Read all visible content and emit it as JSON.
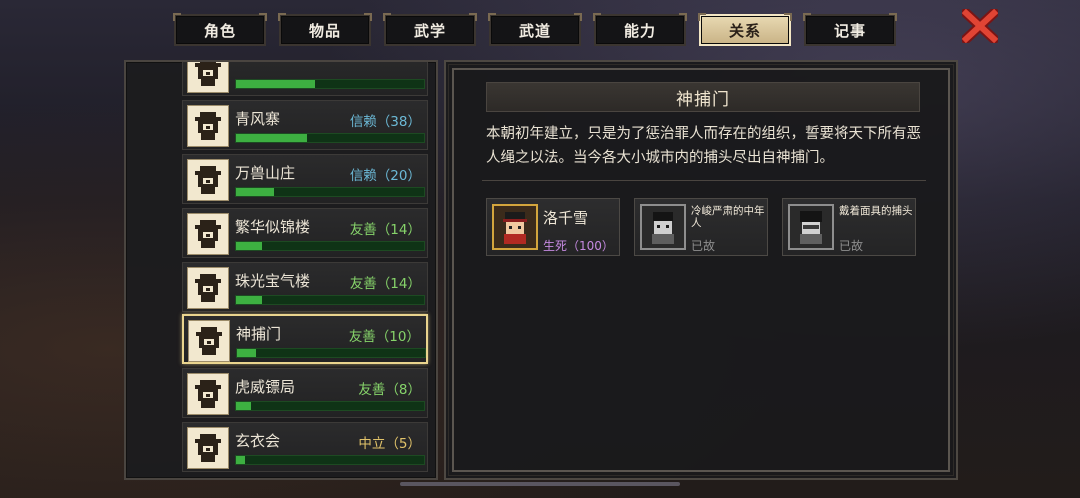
{
  "tabs": [
    {
      "label": "角色",
      "active": false
    },
    {
      "label": "物品",
      "active": false
    },
    {
      "label": "武学",
      "active": false
    },
    {
      "label": "武道",
      "active": false
    },
    {
      "label": "能力",
      "active": false
    },
    {
      "label": "关系",
      "active": true
    },
    {
      "label": "记事",
      "active": false
    }
  ],
  "close_icon": "close-icon",
  "factions": [
    {
      "name": "",
      "status": "",
      "status_type": "trust",
      "progress": 0.42,
      "icon": "faction-emblem-icon"
    },
    {
      "name": "青风寨",
      "status": "信赖（38）",
      "status_type": "trust",
      "progress": 0.38,
      "icon": "mountain-camp-icon"
    },
    {
      "name": "万兽山庄",
      "status": "信赖（20）",
      "status_type": "trust",
      "progress": 0.2,
      "icon": "beast-mask-icon"
    },
    {
      "name": "繁华似锦楼",
      "status": "友善（14）",
      "status_type": "friendly",
      "progress": 0.14,
      "icon": "ornate-emblem-icon"
    },
    {
      "name": "珠光宝气楼",
      "status": "友善（14）",
      "status_type": "friendly",
      "progress": 0.14,
      "icon": "ornate-emblem-icon"
    },
    {
      "name": "神捕门",
      "status": "友善（10）",
      "status_type": "friendly",
      "progress": 0.1,
      "icon": "eye-emblem-icon",
      "selected": true
    },
    {
      "name": "虎威镖局",
      "status": "友善（8）",
      "status_type": "friendly",
      "progress": 0.08,
      "icon": "banner-icon"
    },
    {
      "name": "玄衣会",
      "status": "中立（5）",
      "status_type": "neutral",
      "progress": 0.05,
      "icon": "ornate-emblem-icon"
    }
  ],
  "detail": {
    "title": "神捕门",
    "description": "本朝初年建立，只是为了惩治罪人而存在的组织，誓要将天下所有恶人绳之以法。当今各大小城市内的捕头尽出自神捕门。",
    "members": [
      {
        "name": "洛千雪",
        "status": "生死（100）",
        "status_type": "life",
        "avatar": "constable-portrait-icon"
      },
      {
        "name": "冷峻严肃的中年人",
        "status": "已故",
        "status_type": "dead",
        "avatar": "grey-portrait-icon"
      },
      {
        "name": "戴着面具的捕头",
        "status": "已故",
        "status_type": "dead",
        "avatar": "grey-portrait-icon"
      }
    ]
  },
  "colors": {
    "active_tab": "#e8d9b2",
    "bar_fill": "#3db041",
    "trust": "#6cb9d6",
    "friendly": "#86d36a",
    "neutral": "#e1c36a",
    "life": "#c58ae0",
    "selected_border": "#e9d48e"
  }
}
